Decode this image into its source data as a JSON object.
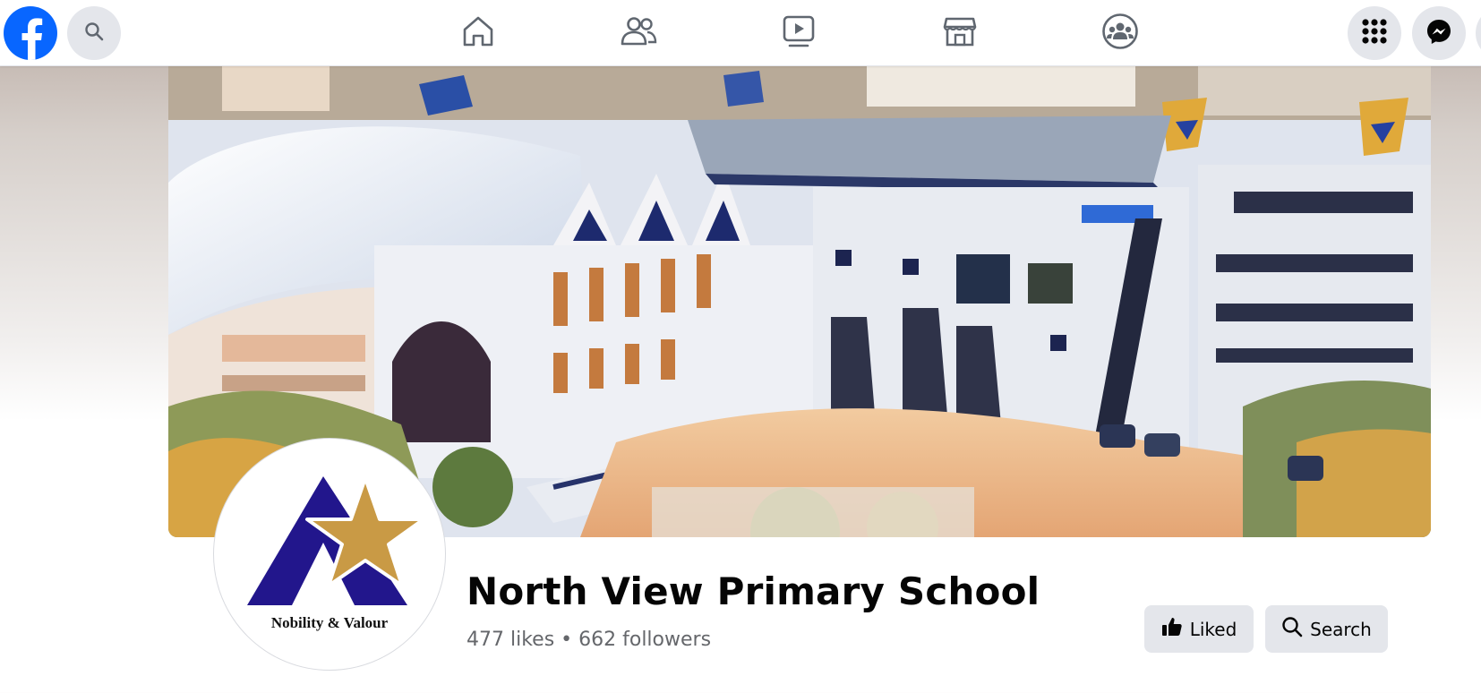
{
  "topbar": {
    "logo_icon": "facebook-logo-icon",
    "search_icon": "search-icon",
    "nav": [
      "home-icon",
      "friends-icon",
      "watch-icon",
      "marketplace-icon",
      "groups-icon"
    ],
    "menu_icon": "grid-menu-icon",
    "messenger_icon": "messenger-icon"
  },
  "page": {
    "name": "North View Primary School",
    "stats": "477 likes • 662 followers",
    "logo_motto": "Nobility & Valour"
  },
  "actions": {
    "liked_label": "Liked",
    "search_label": "Search"
  },
  "colors": {
    "brand_blue": "#0866ff",
    "logo_purple": "#22168c",
    "logo_gold": "#c99a45",
    "button_gray": "#e4e6eb",
    "secondary_text": "#65676b"
  }
}
